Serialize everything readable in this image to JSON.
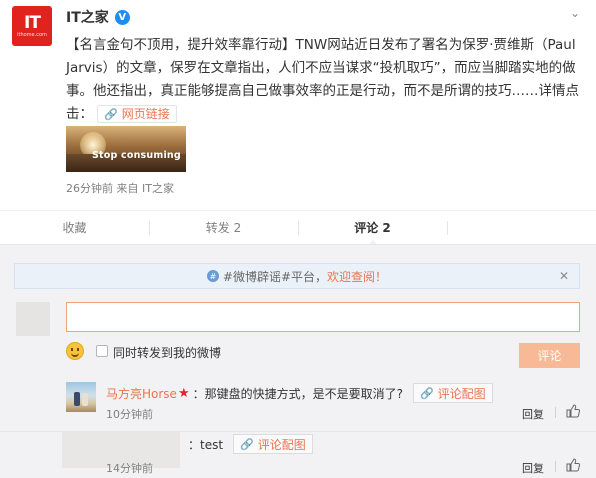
{
  "post": {
    "avatar_text": "IT",
    "avatar_sub": "ithome.com",
    "author": "IT之家",
    "verified_glyph": "V",
    "text": "【名言金句不顶用，提升效率靠行动】TNW网站近日发布了署名为保罗·贾维斯（Paul Jarvis）的文章，保罗在文章指出，人们不应当谋求“投机取巧”，而应当脚踏实地的做事。他还指出，真正能够提高自己做事效率的正是行动，而不是所谓的技巧……详情点击：",
    "link_label": "网页链接",
    "thumbnail_caption": "Stop consuming",
    "meta": "26分钟前 来自 IT之家"
  },
  "actions": {
    "favorite": "收藏",
    "repost": "转发 2",
    "comment": "评论 2"
  },
  "comments_panel": {
    "notice_text": "#微博辟谣#平台，",
    "notice_link": "欢迎查阅！",
    "input_value": "",
    "repost_label": "同时转发到我的微博",
    "submit_label": "评论"
  },
  "comments": [
    {
      "name": "马方亮Horse",
      "text": "：那键盘的快捷方式，是不是要取消了?",
      "image_label": "评论配图",
      "time": "10分钟前",
      "reply": "回复"
    },
    {
      "name": "",
      "text": "：test",
      "image_label": "评论配图",
      "time": "14分钟前",
      "reply": "回复"
    }
  ],
  "colors": {
    "accent": "#eb7350",
    "brand_red": "#e0231c",
    "verified_blue": "#1f8ded"
  },
  "icons": [
    "collapse-icon",
    "verified-icon",
    "link-icon",
    "hash-icon",
    "close-icon",
    "emoji-icon",
    "star-icon",
    "thumb-up-icon"
  ]
}
